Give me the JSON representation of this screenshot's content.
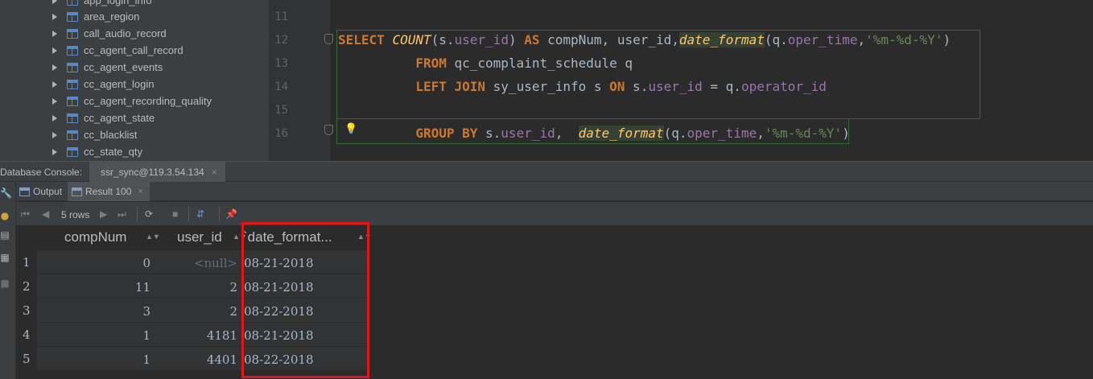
{
  "tree": {
    "items": [
      "app_login_info",
      "area_region",
      "call_audio_record",
      "cc_agent_call_record",
      "cc_agent_events",
      "cc_agent_login",
      "cc_agent_recording_quality",
      "cc_agent_state",
      "cc_blacklist",
      "cc_state_qty"
    ]
  },
  "editor": {
    "line_numbers": [
      "11",
      "12",
      "13",
      "14",
      "15",
      "16"
    ],
    "lines": {
      "l12": {
        "select": "SELECT",
        "count": "COUNT",
        "p1": "(s.",
        "c1": "user_id",
        "p2": ") ",
        "as": "AS",
        "p3": " compNum, ",
        "c2": "user_id",
        "p4": ",",
        "df": "date_format",
        "p5": "(q.",
        "c3": "oper_time",
        "p6": ",",
        "s1": "'%m-%d-%Y'",
        "p7": ")"
      },
      "l13": {
        "from": "FROM",
        "rest": " qc_complaint_schedule q"
      },
      "l14": {
        "join": "LEFT JOIN",
        "p1": " sy_user_info s ",
        "on": "ON",
        "p2": " s.",
        "c1": "user_id",
        "p3": " = q.",
        "c2": "operator_id"
      },
      "l16": {
        "group": "GROUP BY",
        "p1": " s.",
        "c1": "user_id",
        "p2": ",  ",
        "df": "date_format",
        "p3": "(q.",
        "c2": "oper_time",
        "p4": ",",
        "s1": "'%m-%d-%Y'",
        "p5": ")"
      }
    }
  },
  "console": {
    "title": "Database Console:",
    "tab_label": "ssr_sync@119.3.54.134",
    "tab_close": "×"
  },
  "results": {
    "tabs": [
      {
        "label": "Output"
      },
      {
        "label": "Result 100",
        "close": "×"
      }
    ],
    "rows_label": "5 rows",
    "columns": [
      "compNum",
      "user_id",
      "`date_format..."
    ],
    "rows": [
      {
        "n": "1",
        "compNum": "0",
        "user_id": "<null>",
        "date": "08-21-2018"
      },
      {
        "n": "2",
        "compNum": "11",
        "user_id": "2",
        "date": "08-21-2018"
      },
      {
        "n": "3",
        "compNum": "3",
        "user_id": "2",
        "date": "08-22-2018"
      },
      {
        "n": "4",
        "compNum": "1",
        "user_id": "4181",
        "date": "08-21-2018"
      },
      {
        "n": "5",
        "compNum": "1",
        "user_id": "4401",
        "date": "08-22-2018"
      }
    ]
  },
  "colors": {
    "highlight": "#e0161a",
    "keyword": "#cc7832",
    "function": "#ffc66d",
    "column": "#9876aa",
    "string": "#6a8759"
  }
}
